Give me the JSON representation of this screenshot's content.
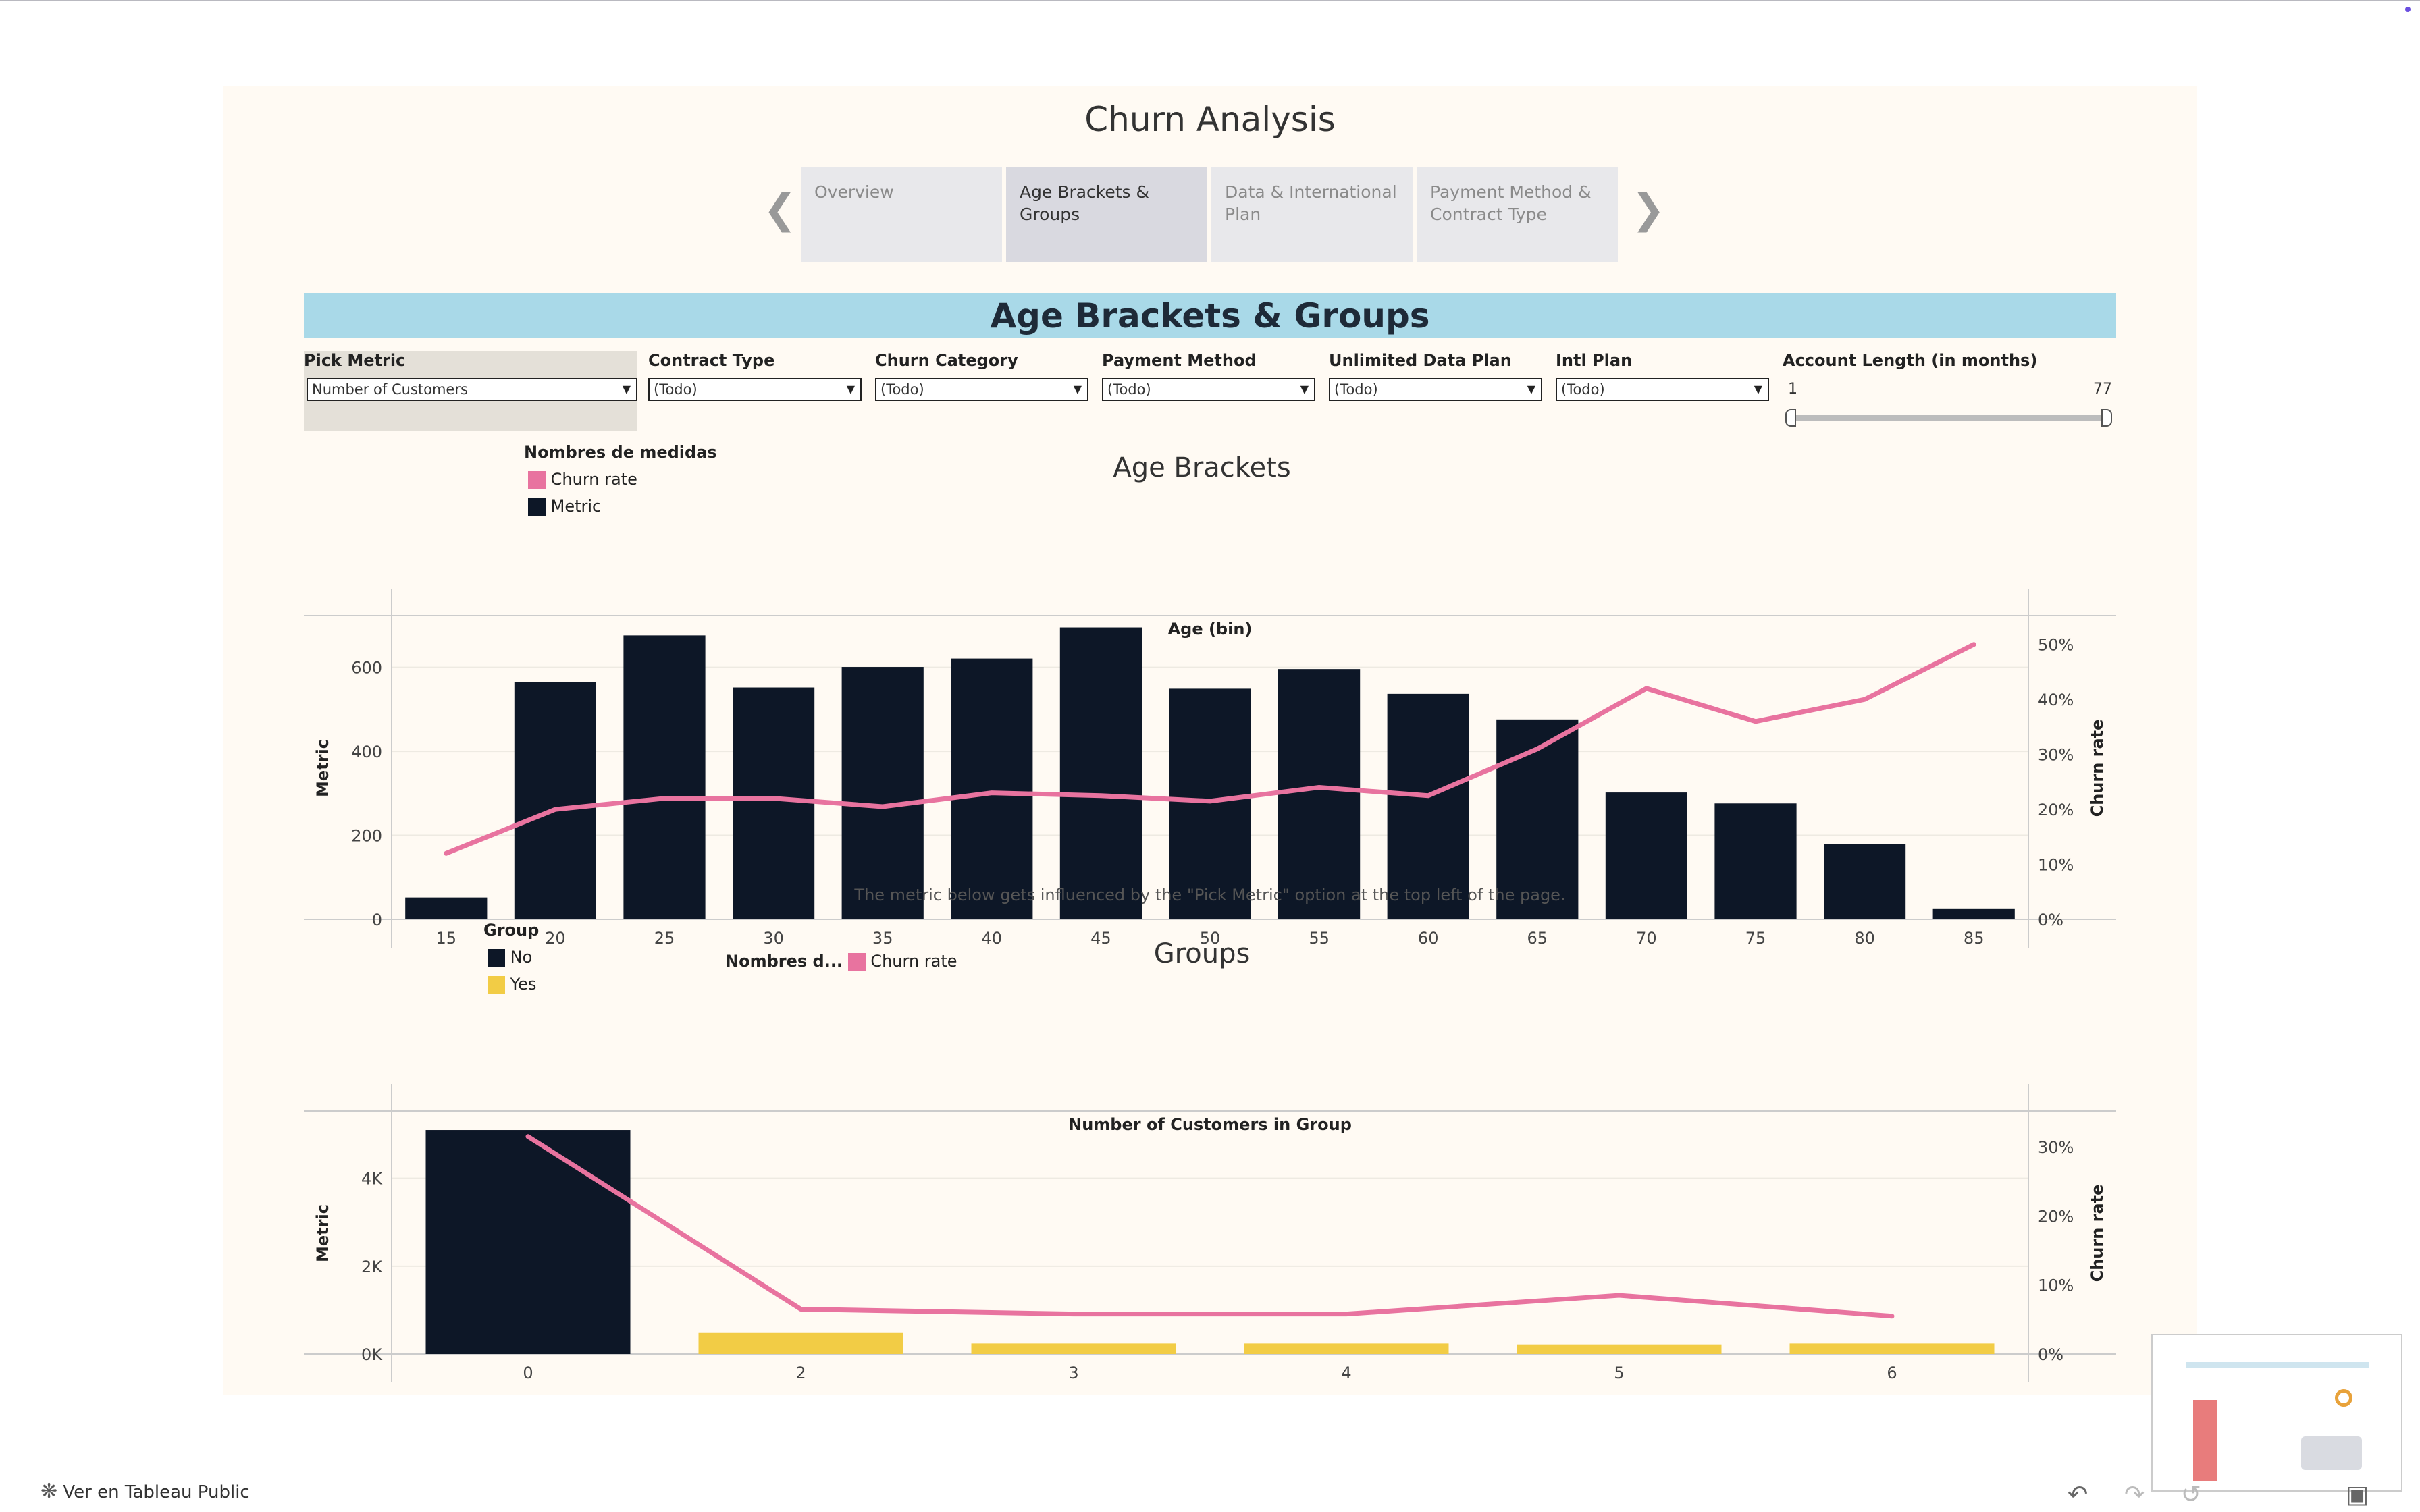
{
  "dashboard_title": "Churn Analysis",
  "tabs": [
    {
      "label": "Overview",
      "active": false
    },
    {
      "label": "Age Brackets & Groups",
      "active": true
    },
    {
      "label": "Data & International Plan",
      "active": false
    },
    {
      "label": "Payment Method & Contract Type",
      "active": false
    }
  ],
  "banner_title": "Age Brackets & Groups",
  "filters": {
    "pick_metric": {
      "label": "Pick Metric",
      "value": "Number of Customers"
    },
    "contract_type": {
      "label": "Contract Type",
      "value": "(Todo)"
    },
    "churn_category": {
      "label": "Churn Category",
      "value": "(Todo)"
    },
    "payment_method": {
      "label": "Payment Method",
      "value": "(Todo)"
    },
    "unlimited_data_plan": {
      "label": "Unlimited Data Plan",
      "value": "(Todo)"
    },
    "intl_plan": {
      "label": "Intl Plan",
      "value": "(Todo)"
    },
    "account_length": {
      "label": "Account Length (in months)",
      "min": "1",
      "max": "77"
    }
  },
  "age_legend": {
    "title": "Nombres de medidas",
    "items": [
      {
        "label": "Churn rate",
        "color": "#e8739f"
      },
      {
        "label": "Metric",
        "color": "#0d1727"
      }
    ]
  },
  "age_chart_title": "Age Brackets",
  "group_chart_title": "Groups",
  "note": "The metric below gets influenced by the \"Pick Metric\" option at the top left of the page.",
  "group_legend": {
    "title": "Group",
    "items": [
      {
        "label": "No",
        "color": "#0d1727"
      },
      {
        "label": "Yes",
        "color": "#f2cc45"
      }
    ]
  },
  "group_legend2": {
    "title": "Nombres d...",
    "item": "Churn rate",
    "color": "#e8739f"
  },
  "footer_text": "Ver en Tableau Public",
  "chart_data": [
    {
      "type": "bar",
      "title": "Age Brackets",
      "xlabel": "Age (bin)",
      "ylabel": "Metric",
      "y2label": "Churn rate",
      "categories": [
        "15",
        "20",
        "25",
        "30",
        "35",
        "40",
        "45",
        "50",
        "55",
        "60",
        "65",
        "70",
        "75",
        "80",
        "85"
      ],
      "yticks": [
        "0",
        "200",
        "400",
        "600"
      ],
      "y2ticks": [
        "0%",
        "10%",
        "20%",
        "30%",
        "40%",
        "50%"
      ],
      "ylim": [
        0,
        720
      ],
      "y2lim": [
        0,
        55
      ],
      "series": [
        {
          "name": "Metric",
          "kind": "bar",
          "color": "#0d1727",
          "values": [
            52,
            565,
            676,
            552,
            601,
            621,
            695,
            549,
            596,
            537,
            476,
            302,
            276,
            180,
            26
          ]
        },
        {
          "name": "Churn rate",
          "kind": "line",
          "color": "#e8739f",
          "values": [
            12.0,
            20.0,
            22.0,
            22.0,
            20.5,
            23.0,
            22.5,
            21.5,
            24.0,
            22.5,
            31.0,
            42.0,
            36.0,
            40.0,
            50.0
          ]
        }
      ]
    },
    {
      "type": "bar",
      "title": "Groups",
      "xlabel": "Number of Customers in Group",
      "ylabel": "Metric",
      "y2label": "Churn rate",
      "categories": [
        "0",
        "2",
        "3",
        "4",
        "5",
        "6"
      ],
      "yticks": [
        "0K",
        "2K",
        "4K"
      ],
      "y2ticks": [
        "0%",
        "10%",
        "20%",
        "30%"
      ],
      "ylim": [
        0,
        5500
      ],
      "y2lim": [
        0,
        35
      ],
      "series": [
        {
          "name": "No",
          "kind": "bar",
          "color": "#0d1727",
          "values": [
            5100,
            null,
            null,
            null,
            null,
            null
          ]
        },
        {
          "name": "Yes",
          "kind": "bar",
          "color": "#f2cc45",
          "values": [
            null,
            480,
            240,
            240,
            220,
            240
          ]
        },
        {
          "name": "Churn rate",
          "kind": "line",
          "color": "#e8739f",
          "values": [
            31.5,
            6.5,
            5.8,
            5.8,
            8.5,
            5.5
          ]
        }
      ]
    }
  ]
}
